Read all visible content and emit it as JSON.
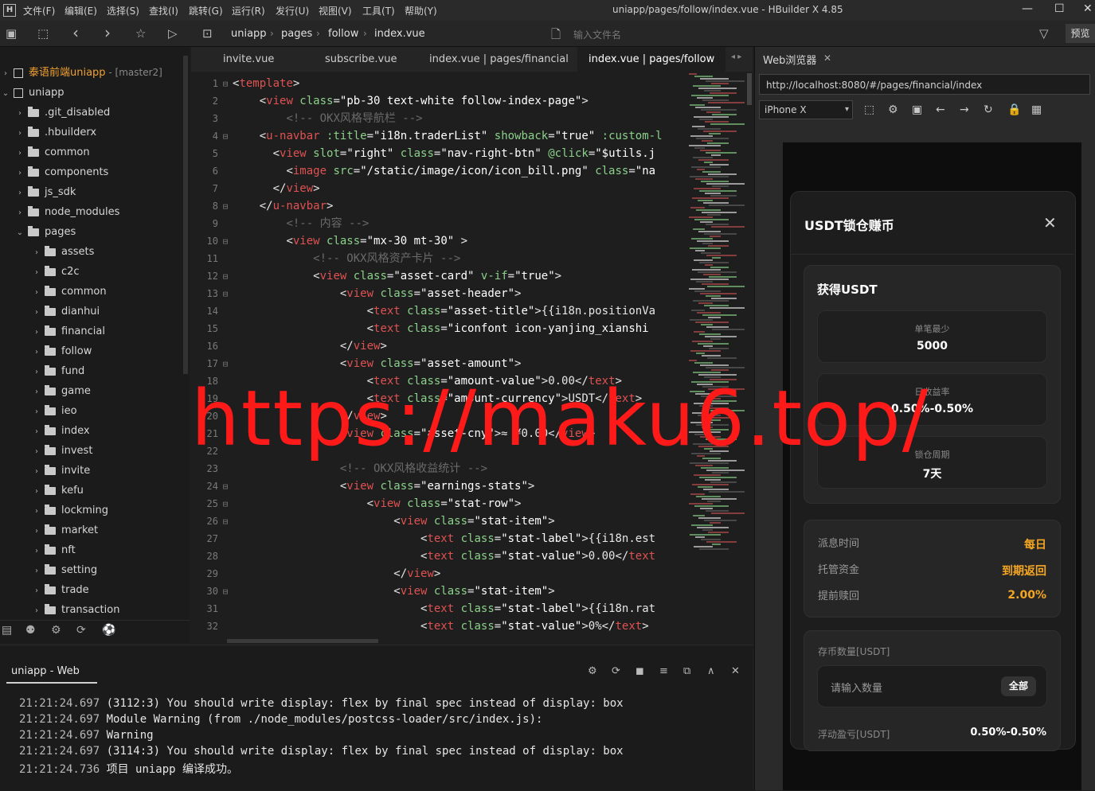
{
  "window": {
    "title": "uniapp/pages/follow/index.vue - HBuilder X 4.85",
    "logo": "H",
    "menu": [
      "文件(F)",
      "编辑(E)",
      "选择(S)",
      "查找(I)",
      "跳转(G)",
      "运行(R)",
      "发行(U)",
      "视图(V)",
      "工具(T)",
      "帮助(Y)"
    ],
    "controls": {
      "minimize": "—",
      "maximize": "☐",
      "close": "✕"
    }
  },
  "toolbar": {
    "icons": {
      "save_all": "▣",
      "save": "⬚",
      "back": "‹",
      "forward": "›",
      "star": "☆",
      "run": "▷",
      "project_box": "⊡",
      "file_icon": "🗋",
      "filter": "▽"
    },
    "breadcrumb": [
      "uniapp",
      "pages",
      "follow",
      "index.vue"
    ],
    "breadcrumb_sep": "›",
    "file_search_placeholder": "输入文件名",
    "preview_label": "预览"
  },
  "sidebar": {
    "projects": [
      {
        "name": "泰语前端uniapp",
        "branch": "- [master2]",
        "expanded": false
      },
      {
        "name": "uniapp",
        "expanded": true
      }
    ],
    "root_folders": [
      ".git_disabled",
      ".hbuilderx",
      "common",
      "components",
      "js_sdk",
      "node_modules"
    ],
    "pages_folder": "pages",
    "page_folders": [
      "assets",
      "c2c",
      "common",
      "dianhui",
      "financial",
      "follow",
      "fund",
      "game",
      "ieo",
      "index",
      "invest",
      "invite",
      "kefu",
      "lockming",
      "market",
      "nft",
      "setting",
      "trade",
      "transaction"
    ],
    "chevrons": {
      "collapsed": "›",
      "expanded": "⌄"
    },
    "bottom_icons": [
      "▤",
      "⚉",
      "⚙",
      "⟳",
      "⚽"
    ]
  },
  "editor": {
    "tabs": [
      "invite.vue",
      "subscribe.vue",
      "index.vue | pages/financial",
      "index.vue | pages/follow"
    ],
    "active_tab": 3,
    "tab_arrows": "◂ ▸",
    "fold_glyph": "⊟",
    "lines": [
      {
        "n": "1",
        "fold": true,
        "indent": 0,
        "parts": [
          [
            "pl",
            "<"
          ],
          [
            "tg",
            "template"
          ],
          [
            "pl",
            ">"
          ]
        ]
      },
      {
        "n": "2",
        "fold": false,
        "indent": 2,
        "parts": [
          [
            "pl",
            "<"
          ],
          [
            "tg",
            "view"
          ],
          [
            "at",
            " class"
          ],
          [
            "pl",
            "="
          ],
          [
            "st",
            "\"pb-30 text-white follow-index-page\""
          ],
          [
            "pl",
            ">"
          ]
        ]
      },
      {
        "n": "3",
        "fold": false,
        "indent": 4,
        "parts": [
          [
            "cm",
            "<!-- OKX风格导航栏 -->"
          ]
        ]
      },
      {
        "n": "4",
        "fold": true,
        "indent": 2,
        "parts": [
          [
            "pl",
            "<"
          ],
          [
            "tg",
            "u-navbar"
          ],
          [
            "at",
            " :title"
          ],
          [
            "pl",
            "="
          ],
          [
            "st",
            "\"i18n.traderList\""
          ],
          [
            "at",
            " showback"
          ],
          [
            "pl",
            "="
          ],
          [
            "st",
            "\"true\""
          ],
          [
            "at",
            " :custom-l"
          ]
        ]
      },
      {
        "n": "5",
        "fold": false,
        "indent": 3,
        "parts": [
          [
            "pl",
            "<"
          ],
          [
            "tg",
            "view"
          ],
          [
            "at",
            " slot"
          ],
          [
            "pl",
            "="
          ],
          [
            "st",
            "\"right\""
          ],
          [
            "at",
            " class"
          ],
          [
            "pl",
            "="
          ],
          [
            "st",
            "\"nav-right-btn\""
          ],
          [
            "at",
            " @click"
          ],
          [
            "pl",
            "="
          ],
          [
            "st",
            "\"$utils.j"
          ]
        ]
      },
      {
        "n": "6",
        "fold": false,
        "indent": 4,
        "parts": [
          [
            "pl",
            "<"
          ],
          [
            "tg",
            "image"
          ],
          [
            "at",
            " src"
          ],
          [
            "pl",
            "="
          ],
          [
            "st",
            "\"/static/image/icon/icon_bill.png\""
          ],
          [
            "at",
            " class"
          ],
          [
            "pl",
            "="
          ],
          [
            "st",
            "\"na"
          ]
        ]
      },
      {
        "n": "7",
        "fold": false,
        "indent": 3,
        "parts": [
          [
            "pl",
            "</"
          ],
          [
            "tg",
            "view"
          ],
          [
            "pl",
            ">"
          ]
        ]
      },
      {
        "n": "8",
        "fold": true,
        "indent": 2,
        "parts": [
          [
            "pl",
            "</"
          ],
          [
            "tg",
            "u-navbar"
          ],
          [
            "pl",
            ">"
          ]
        ]
      },
      {
        "n": "9",
        "fold": false,
        "indent": 4,
        "parts": [
          [
            "cm",
            "<!-- 内容 -->"
          ]
        ]
      },
      {
        "n": "10",
        "fold": true,
        "indent": 4,
        "parts": [
          [
            "pl",
            "<"
          ],
          [
            "tg",
            "view"
          ],
          [
            "at",
            " class"
          ],
          [
            "pl",
            "="
          ],
          [
            "st",
            "\"mx-30 mt-30\""
          ],
          [
            "pl",
            " >"
          ]
        ]
      },
      {
        "n": "11",
        "fold": false,
        "indent": 6,
        "parts": [
          [
            "cm",
            "<!-- OKX风格资产卡片 -->"
          ]
        ]
      },
      {
        "n": "12",
        "fold": true,
        "indent": 6,
        "parts": [
          [
            "pl",
            "<"
          ],
          [
            "tg",
            "view"
          ],
          [
            "at",
            " class"
          ],
          [
            "pl",
            "="
          ],
          [
            "st",
            "\"asset-card\""
          ],
          [
            "at",
            " v-if"
          ],
          [
            "pl",
            "="
          ],
          [
            "st",
            "\"true\""
          ],
          [
            "pl",
            ">"
          ]
        ]
      },
      {
        "n": "13",
        "fold": true,
        "indent": 8,
        "parts": [
          [
            "pl",
            "<"
          ],
          [
            "tg",
            "view"
          ],
          [
            "at",
            " class"
          ],
          [
            "pl",
            "="
          ],
          [
            "st",
            "\"asset-header\""
          ],
          [
            "pl",
            ">"
          ]
        ]
      },
      {
        "n": "14",
        "fold": false,
        "indent": 10,
        "parts": [
          [
            "pl",
            "<"
          ],
          [
            "tg",
            "text"
          ],
          [
            "at",
            " class"
          ],
          [
            "pl",
            "="
          ],
          [
            "st",
            "\"asset-title\""
          ],
          [
            "pl",
            ">{{i18n.positionVa"
          ]
        ]
      },
      {
        "n": "15",
        "fold": false,
        "indent": 10,
        "parts": [
          [
            "pl",
            "<"
          ],
          [
            "tg",
            "text"
          ],
          [
            "at",
            " class"
          ],
          [
            "pl",
            "="
          ],
          [
            "st",
            "\"iconfont icon-yanjing_xianshi"
          ]
        ]
      },
      {
        "n": "16",
        "fold": false,
        "indent": 8,
        "parts": [
          [
            "pl",
            "</"
          ],
          [
            "tg",
            "view"
          ],
          [
            "pl",
            ">"
          ]
        ]
      },
      {
        "n": "17",
        "fold": true,
        "indent": 8,
        "parts": [
          [
            "pl",
            "<"
          ],
          [
            "tg",
            "view"
          ],
          [
            "at",
            " class"
          ],
          [
            "pl",
            "="
          ],
          [
            "st",
            "\"asset-amount\""
          ],
          [
            "pl",
            ">"
          ]
        ]
      },
      {
        "n": "18",
        "fold": false,
        "indent": 10,
        "parts": [
          [
            "pl",
            "<"
          ],
          [
            "tg",
            "text"
          ],
          [
            "at",
            " class"
          ],
          [
            "pl",
            "="
          ],
          [
            "st",
            "\"amount-value\""
          ],
          [
            "pl",
            ">0.00</"
          ],
          [
            "tg",
            "text"
          ],
          [
            "pl",
            ">"
          ]
        ]
      },
      {
        "n": "19",
        "fold": false,
        "indent": 10,
        "parts": [
          [
            "pl",
            "<"
          ],
          [
            "tg",
            "text"
          ],
          [
            "at",
            " class"
          ],
          [
            "pl",
            "="
          ],
          [
            "st",
            "\"amount-currency\""
          ],
          [
            "pl",
            ">USDT</"
          ],
          [
            "tg",
            "text"
          ],
          [
            "pl",
            ">"
          ]
        ]
      },
      {
        "n": "20",
        "fold": false,
        "indent": 8,
        "parts": [
          [
            "pl",
            "</"
          ],
          [
            "tg",
            "view"
          ],
          [
            "pl",
            ">"
          ]
        ]
      },
      {
        "n": "21",
        "fold": false,
        "indent": 8,
        "parts": [
          [
            "pl",
            "<"
          ],
          [
            "tg",
            "view"
          ],
          [
            "at",
            " class"
          ],
          [
            "pl",
            "="
          ],
          [
            "st",
            "\"asset-cny\""
          ],
          [
            "pl",
            ">≈ ¥0.00</"
          ],
          [
            "tg",
            "view"
          ],
          [
            "pl",
            ">"
          ]
        ]
      },
      {
        "n": "22",
        "fold": false,
        "indent": 0,
        "parts": []
      },
      {
        "n": "23",
        "fold": false,
        "indent": 8,
        "parts": [
          [
            "cm",
            "<!-- OKX风格收益统计 -->"
          ]
        ]
      },
      {
        "n": "24",
        "fold": true,
        "indent": 8,
        "parts": [
          [
            "pl",
            "<"
          ],
          [
            "tg",
            "view"
          ],
          [
            "at",
            " class"
          ],
          [
            "pl",
            "="
          ],
          [
            "st",
            "\"earnings-stats\""
          ],
          [
            "pl",
            ">"
          ]
        ]
      },
      {
        "n": "25",
        "fold": true,
        "indent": 10,
        "parts": [
          [
            "pl",
            "<"
          ],
          [
            "tg",
            "view"
          ],
          [
            "at",
            " class"
          ],
          [
            "pl",
            "="
          ],
          [
            "st",
            "\"stat-row\""
          ],
          [
            "pl",
            ">"
          ]
        ]
      },
      {
        "n": "26",
        "fold": true,
        "indent": 12,
        "parts": [
          [
            "pl",
            "<"
          ],
          [
            "tg",
            "view"
          ],
          [
            "at",
            " class"
          ],
          [
            "pl",
            "="
          ],
          [
            "st",
            "\"stat-item\""
          ],
          [
            "pl",
            ">"
          ]
        ]
      },
      {
        "n": "27",
        "fold": false,
        "indent": 14,
        "parts": [
          [
            "pl",
            "<"
          ],
          [
            "tg",
            "text"
          ],
          [
            "at",
            " class"
          ],
          [
            "pl",
            "="
          ],
          [
            "st",
            "\"stat-label\""
          ],
          [
            "pl",
            ">{{i18n.est"
          ]
        ]
      },
      {
        "n": "28",
        "fold": false,
        "indent": 14,
        "parts": [
          [
            "pl",
            "<"
          ],
          [
            "tg",
            "text"
          ],
          [
            "at",
            " class"
          ],
          [
            "pl",
            "="
          ],
          [
            "st",
            "\"stat-value\""
          ],
          [
            "pl",
            ">0.00</"
          ],
          [
            "tg",
            "text"
          ]
        ]
      },
      {
        "n": "29",
        "fold": false,
        "indent": 12,
        "parts": [
          [
            "pl",
            "</"
          ],
          [
            "tg",
            "view"
          ],
          [
            "pl",
            ">"
          ]
        ]
      },
      {
        "n": "30",
        "fold": true,
        "indent": 12,
        "parts": [
          [
            "pl",
            "<"
          ],
          [
            "tg",
            "view"
          ],
          [
            "at",
            " class"
          ],
          [
            "pl",
            "="
          ],
          [
            "st",
            "\"stat-item\""
          ],
          [
            "pl",
            ">"
          ]
        ]
      },
      {
        "n": "31",
        "fold": false,
        "indent": 14,
        "parts": [
          [
            "pl",
            "<"
          ],
          [
            "tg",
            "text"
          ],
          [
            "at",
            " class"
          ],
          [
            "pl",
            "="
          ],
          [
            "st",
            "\"stat-label\""
          ],
          [
            "pl",
            ">{{i18n.rat"
          ]
        ]
      },
      {
        "n": "32",
        "fold": false,
        "indent": 14,
        "parts": [
          [
            "pl",
            "<"
          ],
          [
            "tg",
            "text"
          ],
          [
            "at",
            " class"
          ],
          [
            "pl",
            "="
          ],
          [
            "st",
            "\"stat-value\""
          ],
          [
            "pl",
            ">0%</"
          ],
          [
            "tg",
            "text"
          ],
          [
            "pl",
            ">"
          ]
        ]
      }
    ],
    "colors": {
      "tag": "#e05252",
      "attr": "#8bd18b",
      "string": "#ffffff",
      "comment": "#6a6a6a"
    }
  },
  "console": {
    "tab_label": "uniapp - Web",
    "icons": [
      "⚙",
      "⟳",
      "◼",
      "≡",
      "⧉",
      "∧",
      "✕"
    ],
    "lines": [
      {
        "time": "21:21:24.697",
        "text": " (3112:3) You should write display: flex by final spec instead of display: box"
      },
      {
        "time": "21:21:24.697",
        "text": " Module Warning (from ./node_modules/postcss-loader/src/index.js):"
      },
      {
        "time": "21:21:24.697",
        "text": " Warning"
      },
      {
        "time": "21:21:24.697",
        "text": " (3114:3) You should write display: flex by final spec instead of display: box"
      },
      {
        "time": "21:21:24.736",
        "text": " 项目 uniapp 编译成功。"
      }
    ]
  },
  "browser": {
    "tab_label": "Web浏览器",
    "tab_close": "✕",
    "url": "http://localhost:8080/#/pages/financial/index",
    "device": "iPhone X",
    "device_caret": "▾",
    "icons": [
      "⬚",
      "⚙",
      "▣",
      "←",
      "→",
      "↻",
      "🔒",
      "▦"
    ]
  },
  "modal": {
    "title": "USDT锁仓赚币",
    "close_icon": "✕",
    "earn_title": "获得USDT",
    "stats": [
      {
        "label": "单笔最少",
        "value": "5000"
      },
      {
        "label": "日收益率",
        "value": "0.50%-0.50%"
      },
      {
        "label": "锁仓周期",
        "value": "7天"
      }
    ],
    "details": [
      {
        "label": "派息时间",
        "value": "每日"
      },
      {
        "label": "托管资金",
        "value": "到期返回"
      },
      {
        "label": "提前赎回",
        "value": "2.00%"
      }
    ],
    "amount_label": "存币数量[USDT]",
    "amount_placeholder": "请输入数量",
    "all_button": "全部",
    "float_label": "浮动盈亏[USDT]",
    "float_value": "0.50%-0.50%"
  },
  "watermark": "https://maku6.top/"
}
